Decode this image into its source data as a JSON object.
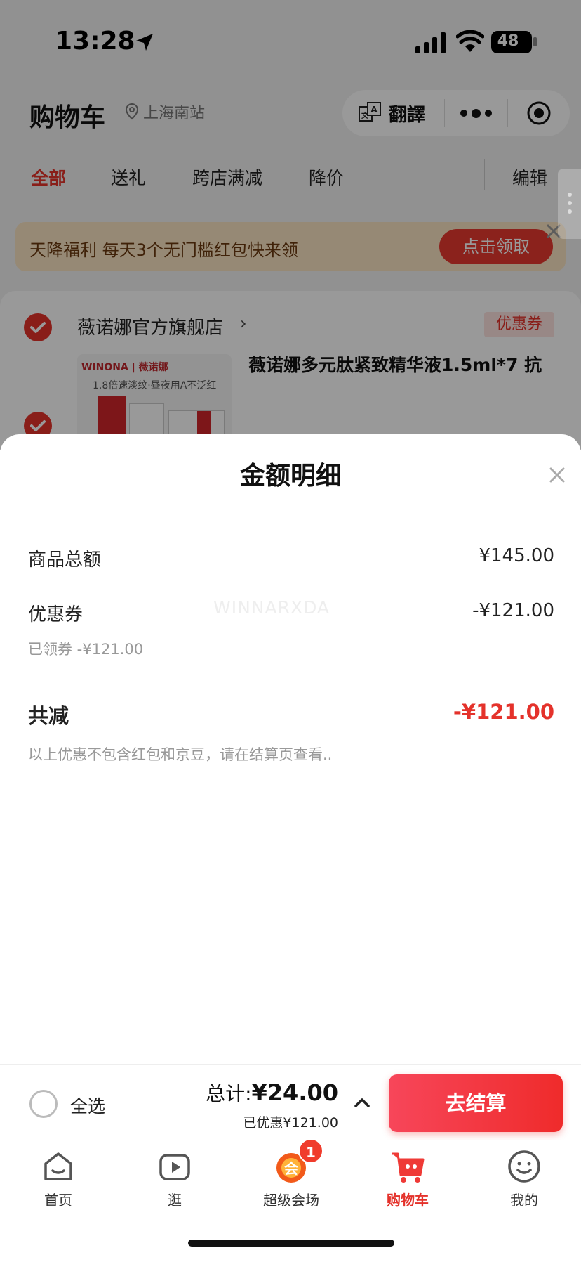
{
  "status_bar": {
    "time": "13:28",
    "battery": "48"
  },
  "nav": {
    "title": "购物车",
    "location": "上海南站",
    "translate_label": "翻譯"
  },
  "tabs": [
    {
      "label": "全部",
      "active": true
    },
    {
      "label": "送礼",
      "active": false
    },
    {
      "label": "跨店满减",
      "active": false
    },
    {
      "label": "降价",
      "active": false
    }
  ],
  "edit_label": "编辑",
  "banner": {
    "text": "天降福利 每天3个无门槛红包快来领",
    "button": "点击领取"
  },
  "store": {
    "name": "薇诺娜官方旗舰店",
    "coupon_tag": "优惠券",
    "product_title": "薇诺娜多元肽紧致精华液1.5ml*7 抗",
    "product_image_brand": "WINONA | 薇诺娜",
    "product_image_line": "1.8倍速淡纹·昼夜用A不泛红"
  },
  "sheet": {
    "title": "金额明细",
    "goods_total_label": "商品总额",
    "goods_total_value": "¥145.00",
    "coupon_label": "优惠券",
    "coupon_value": "-¥121.00",
    "coupon_sub": "已领券 -¥121.00",
    "watermark": "WINNARXDA",
    "total_reduce_label": "共减",
    "total_reduce_value": "-¥121.00",
    "note": "以上优惠不包含红包和京豆，请在结算页查看.."
  },
  "settle": {
    "select_all": "全选",
    "total_prefix": "总计:",
    "total_value": "¥24.00",
    "saved": "已优惠¥121.00",
    "checkout": "去结算"
  },
  "tabbar": [
    {
      "label": "首页",
      "icon": "home-icon",
      "active": false
    },
    {
      "label": "逛",
      "icon": "video-icon",
      "active": false
    },
    {
      "label": "超级会场",
      "icon": "venue-icon",
      "active": false,
      "badge": "1"
    },
    {
      "label": "购物车",
      "icon": "cart-icon",
      "active": true
    },
    {
      "label": "我的",
      "icon": "profile-icon",
      "active": false
    }
  ],
  "colors": {
    "accent": "#e4322b",
    "banner_bg": "#fbe5c4",
    "checkout_start": "#f7465a",
    "checkout_end": "#ef2b2b"
  }
}
